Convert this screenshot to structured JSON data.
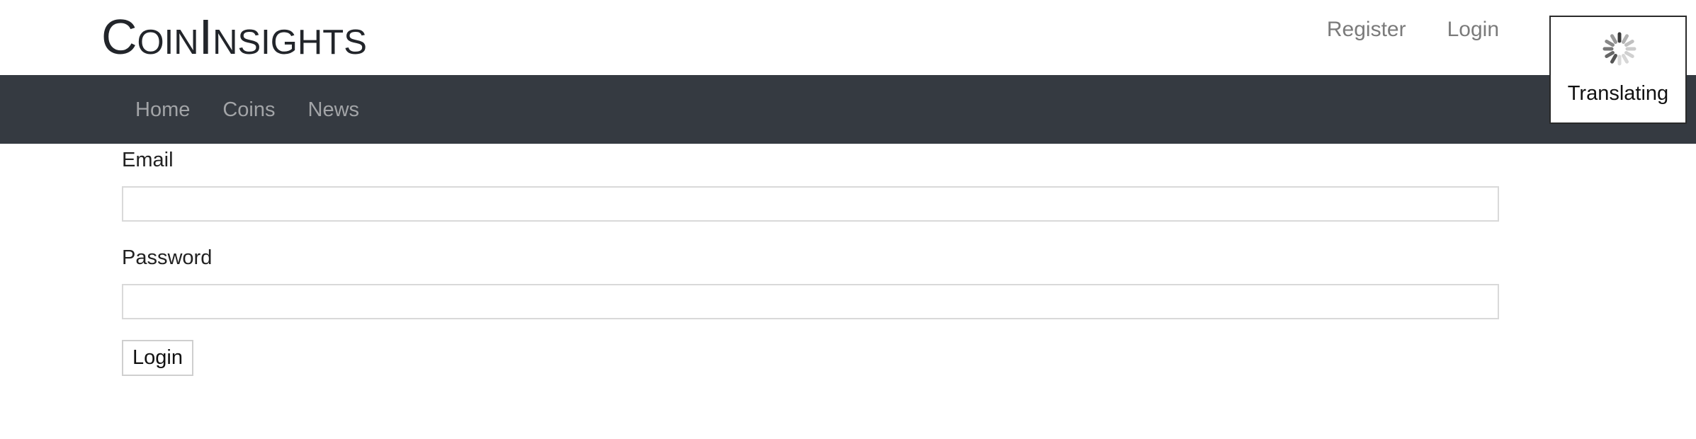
{
  "header": {
    "brand": "CoinInsights",
    "register_label": "Register",
    "login_label": "Login"
  },
  "nav": {
    "items": [
      {
        "label": "Home"
      },
      {
        "label": "Coins"
      },
      {
        "label": "News"
      }
    ]
  },
  "form": {
    "email_label": "Email",
    "email_value": "",
    "password_label": "Password",
    "password_value": "",
    "submit_label": "Login"
  },
  "overlay": {
    "status_text": "Translating"
  },
  "colors": {
    "navbar_bg": "#353a41",
    "nav_text": "#a2a4a7",
    "top_link_text": "#7b7b7b",
    "brand_text": "#22252a"
  },
  "icons": {
    "spinner": "loading-spinner-icon"
  }
}
